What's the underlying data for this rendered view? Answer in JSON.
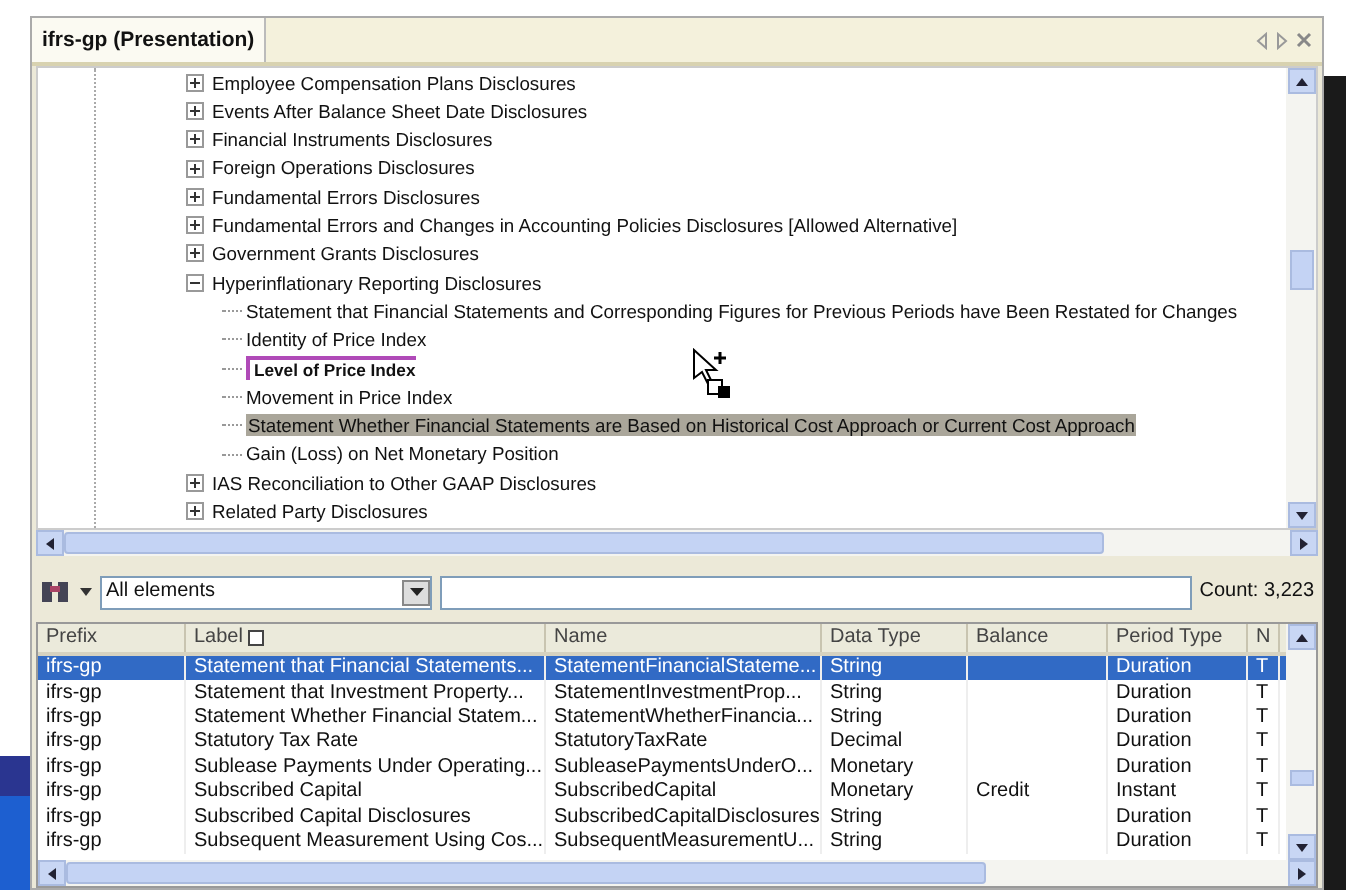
{
  "tab": {
    "title": "ifrs-gp (Presentation)"
  },
  "tree": [
    {
      "label": "Employee Compensation Plans Disclosures",
      "expanded": false
    },
    {
      "label": "Events After Balance Sheet Date Disclosures",
      "expanded": false
    },
    {
      "label": "Financial Instruments Disclosures",
      "expanded": false
    },
    {
      "label": "Foreign Operations Disclosures",
      "expanded": false
    },
    {
      "label": "Fundamental Errors Disclosures",
      "expanded": false
    },
    {
      "label": "Fundamental Errors and Changes in Accounting Policies Disclosures [Allowed Alternative]",
      "expanded": false
    },
    {
      "label": "Government Grants Disclosures",
      "expanded": false
    },
    {
      "label": "Hyperinflationary Reporting Disclosures",
      "expanded": true,
      "children": [
        {
          "label": "Statement that Financial Statements and Corresponding Figures for Previous Periods have Been Restated for Changes",
          "selected": false,
          "drop_target": false
        },
        {
          "label": "Identity of Price Index",
          "selected": false,
          "drop_target": false
        },
        {
          "label": "Level of Price Index",
          "selected": false,
          "drop_target": true
        },
        {
          "label": "Movement in Price Index",
          "selected": false,
          "drop_target": false
        },
        {
          "label": "Statement Whether Financial Statements are Based on Historical Cost Approach or Current Cost Approach",
          "selected": true,
          "drop_target": false
        },
        {
          "label": "Gain (Loss) on Net Monetary Position",
          "selected": false,
          "drop_target": false
        }
      ]
    },
    {
      "label": "IAS Reconciliation to Other GAAP Disclosures",
      "expanded": false
    },
    {
      "label": "Related Party Disclosures",
      "expanded": false
    }
  ],
  "filter": {
    "value": "All elements",
    "count": "Count: 3,223"
  },
  "table": {
    "columns": [
      "Prefix",
      "Label",
      "Name",
      "Data Type",
      "Balance",
      "Period Type",
      "N"
    ],
    "rows": [
      {
        "selected": true,
        "cells": [
          "ifrs-gp",
          "Statement that Financial Statements...",
          "StatementFinancialStateme...",
          "String",
          "",
          "Duration",
          "T"
        ]
      },
      {
        "selected": false,
        "cells": [
          "ifrs-gp",
          "Statement that Investment Property...",
          "StatementInvestmentProp...",
          "String",
          "",
          "Duration",
          "T"
        ]
      },
      {
        "selected": false,
        "cells": [
          "ifrs-gp",
          "Statement Whether Financial Statem...",
          "StatementWhetherFinancia...",
          "String",
          "",
          "Duration",
          "T"
        ]
      },
      {
        "selected": false,
        "cells": [
          "ifrs-gp",
          "Statutory Tax Rate",
          "StatutoryTaxRate",
          "Decimal",
          "",
          "Duration",
          "T"
        ]
      },
      {
        "selected": false,
        "cells": [
          "ifrs-gp",
          "Sublease Payments Under Operating...",
          "SubleasePaymentsUnderO...",
          "Monetary",
          "",
          "Duration",
          "T"
        ]
      },
      {
        "selected": false,
        "cells": [
          "ifrs-gp",
          "Subscribed Capital",
          "SubscribedCapital",
          "Monetary",
          "Credit",
          "Instant",
          "T"
        ]
      },
      {
        "selected": false,
        "cells": [
          "ifrs-gp",
          "Subscribed Capital Disclosures",
          "SubscribedCapitalDisclosures",
          "String",
          "",
          "Duration",
          "T"
        ]
      },
      {
        "selected": false,
        "cells": [
          "ifrs-gp",
          "Subsequent Measurement Using Cos...",
          "SubsequentMeasurementU...",
          "String",
          "",
          "Duration",
          "T"
        ]
      }
    ]
  }
}
